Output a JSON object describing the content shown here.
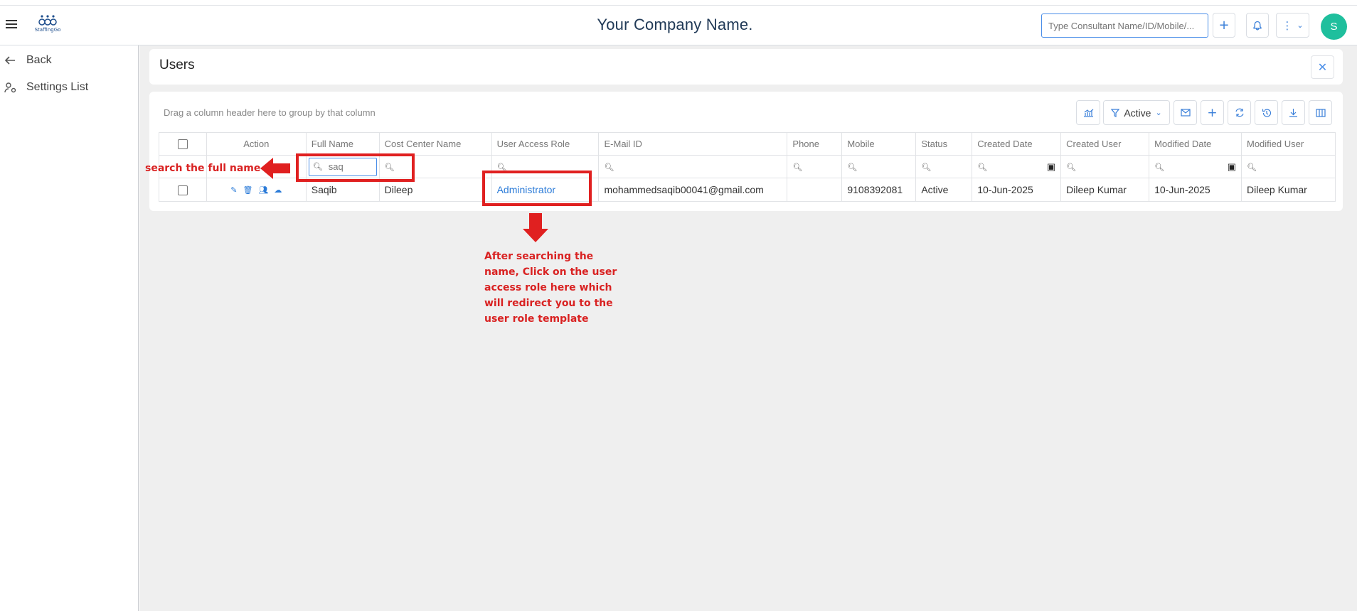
{
  "header": {
    "logo_text": "StaffingGo",
    "company_name": "Your Company Name.",
    "search_placeholder": "Type Consultant Name/ID/Mobile/...",
    "avatar_initial": "S"
  },
  "sidebar": {
    "items": [
      {
        "label": "Back",
        "icon": "arrow-left-icon"
      },
      {
        "label": "Settings List",
        "icon": "user-settings-icon"
      }
    ]
  },
  "page": {
    "title": "Users",
    "group_hint": "Drag a column header here to group by that column",
    "status_filter": "Active"
  },
  "grid": {
    "columns": [
      "Action",
      "Full Name",
      "Cost Center Name",
      "User Access Role",
      "E-Mail ID",
      "Phone",
      "Mobile",
      "Status",
      "Created Date",
      "Created User",
      "Modified Date",
      "Modified User"
    ],
    "filters": {
      "full_name": "saq"
    },
    "rows": [
      {
        "full_name": "Saqib",
        "cost_center": "Dileep",
        "role": "Administrator",
        "email": "mohammedsaqib00041@gmail.com",
        "phone": "",
        "mobile": "9108392081",
        "status": "Active",
        "created_date": "10-Jun-2025",
        "created_user": "Dileep Kumar",
        "modified_date": "10-Jun-2025",
        "modified_user": "Dileep Kumar"
      }
    ]
  },
  "annotations": {
    "search_label": "search the full name",
    "note_lines": [
      "After searching the",
      "name, Click on the user",
      "access role here which",
      "will redirect you to the",
      "user role template"
    ],
    "color": "#e02020"
  }
}
